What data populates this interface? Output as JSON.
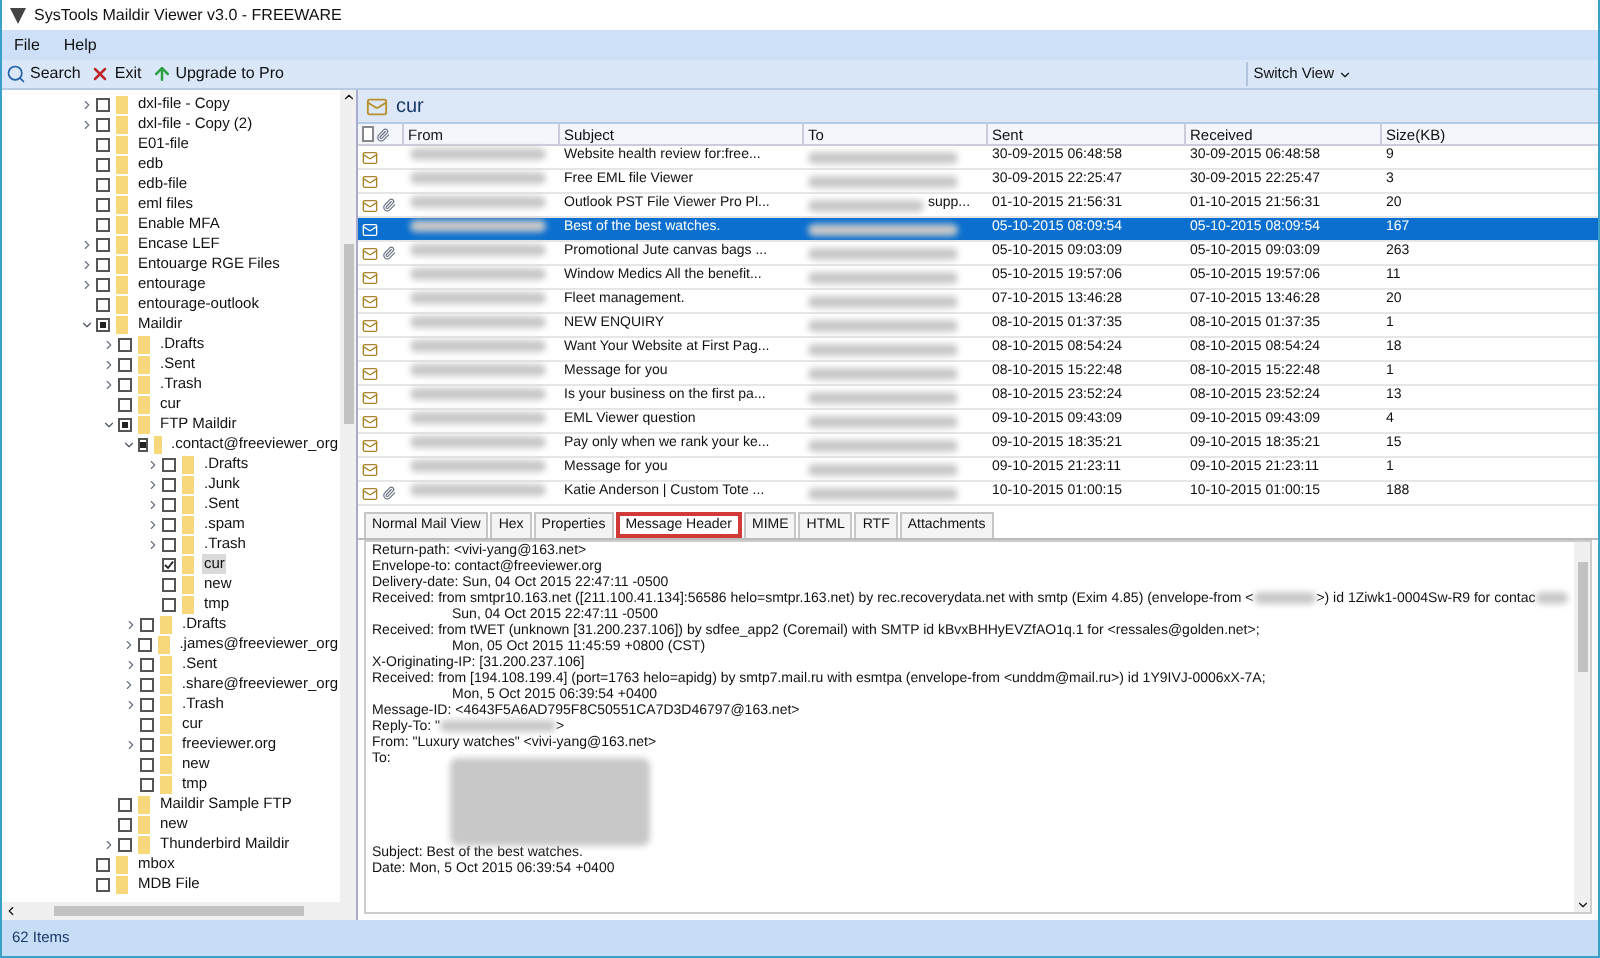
{
  "window": {
    "title": "SysTools Maildir Viewer v3.0 - FREEWARE"
  },
  "menu": [
    "File",
    "Help"
  ],
  "toolbar": [
    {
      "kind": "search",
      "label": "Search"
    },
    {
      "kind": "exit",
      "label": "Exit"
    },
    {
      "kind": "upgrade",
      "label": "Upgrade to Pro"
    }
  ],
  "switch_view": "Switch View",
  "tree": [
    {
      "label": "dxl-file - Copy",
      "checked": false,
      "expanded": false,
      "selected": false
    },
    {
      "label": "dxl-file - Copy (2)",
      "checked": false,
      "expanded": false,
      "selected": false
    },
    {
      "label": "E01-file",
      "checked": false,
      "selected": false
    },
    {
      "label": "edb",
      "checked": false,
      "selected": false
    },
    {
      "label": "edb-file",
      "checked": false,
      "selected": false
    },
    {
      "label": "eml files",
      "checked": false,
      "selected": false
    },
    {
      "label": "Enable MFA",
      "checked": false,
      "selected": false
    },
    {
      "label": "Encase LEF",
      "checked": false,
      "expanded": false,
      "selected": false
    },
    {
      "label": "Entouarge RGE Files",
      "checked": false,
      "expanded": false,
      "selected": false
    },
    {
      "label": "entourage",
      "checked": false,
      "expanded": false,
      "selected": false
    },
    {
      "label": "entourage-outlook",
      "checked": false,
      "selected": false
    },
    {
      "label": "Maildir",
      "partial": true,
      "expanded": true,
      "selected": false,
      "children": [
        {
          "label": ".Drafts",
          "checked": false,
          "expanded": false,
          "selected": false
        },
        {
          "label": ".Sent",
          "checked": false,
          "expanded": false,
          "selected": false
        },
        {
          "label": ".Trash",
          "checked": false,
          "expanded": false,
          "selected": false
        },
        {
          "label": "cur",
          "checked": false,
          "selected": false
        },
        {
          "label": "FTP Maildir",
          "partial": true,
          "expanded": true,
          "selected": false,
          "children": [
            {
              "label": ".contact@freeviewer_org",
              "partial": true,
              "expanded": true,
              "selected": false,
              "children": [
                {
                  "label": ".Drafts",
                  "checked": false,
                  "expanded": false,
                  "selected": false
                },
                {
                  "label": ".Junk",
                  "checked": false,
                  "expanded": false,
                  "selected": false
                },
                {
                  "label": ".Sent",
                  "checked": false,
                  "expanded": false,
                  "selected": false
                },
                {
                  "label": ".spam",
                  "checked": false,
                  "expanded": false,
                  "selected": false
                },
                {
                  "label": ".Trash",
                  "checked": false,
                  "expanded": false,
                  "selected": false
                },
                {
                  "label": "cur",
                  "checked": true,
                  "selected": true
                },
                {
                  "label": "new",
                  "checked": false,
                  "selected": false
                },
                {
                  "label": "tmp",
                  "checked": false,
                  "selected": false
                }
              ]
            },
            {
              "label": ".Drafts",
              "checked": false,
              "expanded": false,
              "selected": false
            },
            {
              "label": ".james@freeviewer_org",
              "checked": false,
              "expanded": false,
              "selected": false
            },
            {
              "label": ".Sent",
              "checked": false,
              "expanded": false,
              "selected": false
            },
            {
              "label": ".share@freeviewer_org",
              "checked": false,
              "expanded": false,
              "selected": false
            },
            {
              "label": ".Trash",
              "checked": false,
              "expanded": false,
              "selected": false
            },
            {
              "label": "cur",
              "checked": false,
              "selected": false
            },
            {
              "label": "freeviewer.org",
              "checked": false,
              "expanded": false,
              "selected": false
            },
            {
              "label": "new",
              "checked": false,
              "selected": false
            },
            {
              "label": "tmp",
              "checked": false,
              "selected": false
            }
          ]
        },
        {
          "label": "Maildir Sample FTP",
          "checked": false,
          "selected": false
        },
        {
          "label": "new",
          "checked": false,
          "selected": false
        },
        {
          "label": "Thunderbird Maildir",
          "checked": false,
          "expanded": false,
          "selected": false
        }
      ]
    },
    {
      "label": "mbox",
      "checked": false,
      "selected": false
    },
    {
      "label": "MDB File",
      "checked": false,
      "selected": false
    }
  ],
  "folder_title": "cur",
  "table": {
    "columns": [
      "From",
      "Subject",
      "To",
      "Sent",
      "Received",
      "Size(KB)"
    ],
    "rows": [
      {
        "attachment": false,
        "selected": false,
        "subject": "Website health review for:free...",
        "sent": "30-09-2015 06:48:58",
        "received": "30-09-2015 06:48:58",
        "size": "9"
      },
      {
        "attachment": false,
        "selected": false,
        "subject": "Free EML file Viewer",
        "sent": "30-09-2015 22:25:47",
        "received": "30-09-2015 22:25:47",
        "size": "3"
      },
      {
        "attachment": true,
        "selected": false,
        "subject": "Outlook PST File Viewer Pro Pl...",
        "to_suffix": "supp...",
        "sent": "01-10-2015 21:56:31",
        "received": "01-10-2015 21:56:31",
        "size": "20"
      },
      {
        "attachment": false,
        "selected": true,
        "subject": "Best of the best watches.",
        "sent": "05-10-2015 08:09:54",
        "received": "05-10-2015 08:09:54",
        "size": "167"
      },
      {
        "attachment": true,
        "selected": false,
        "subject": "Promotional Jute canvas bags ...",
        "sent": "05-10-2015 09:03:09",
        "received": "05-10-2015 09:03:09",
        "size": "263"
      },
      {
        "attachment": false,
        "selected": false,
        "subject": "Window Medics All the benefit...",
        "sent": "05-10-2015 19:57:06",
        "received": "05-10-2015 19:57:06",
        "size": "11"
      },
      {
        "attachment": false,
        "selected": false,
        "subject": "Fleet management.",
        "sent": "07-10-2015 13:46:28",
        "received": "07-10-2015 13:46:28",
        "size": "20"
      },
      {
        "attachment": false,
        "selected": false,
        "subject": "NEW ENQUIRY",
        "sent": "08-10-2015 01:37:35",
        "received": "08-10-2015 01:37:35",
        "size": "1"
      },
      {
        "attachment": false,
        "selected": false,
        "subject": "Want Your Website at First Pag...",
        "sent": "08-10-2015 08:54:24",
        "received": "08-10-2015 08:54:24",
        "size": "18"
      },
      {
        "attachment": false,
        "selected": false,
        "subject": "Message for you",
        "sent": "08-10-2015 15:22:48",
        "received": "08-10-2015 15:22:48",
        "size": "1"
      },
      {
        "attachment": false,
        "selected": false,
        "subject": "Is your business on the first pa...",
        "sent": "08-10-2015 23:52:24",
        "received": "08-10-2015 23:52:24",
        "size": "13"
      },
      {
        "attachment": false,
        "selected": false,
        "subject": "EML Viewer question",
        "sent": "09-10-2015 09:43:09",
        "received": "09-10-2015 09:43:09",
        "size": "4"
      },
      {
        "attachment": false,
        "selected": false,
        "subject": "Pay only when we rank your ke...",
        "sent": "09-10-2015 18:35:21",
        "received": "09-10-2015 18:35:21",
        "size": "15"
      },
      {
        "attachment": false,
        "selected": false,
        "subject": "Message for you",
        "sent": "09-10-2015 21:23:11",
        "received": "09-10-2015 21:23:11",
        "size": "1"
      },
      {
        "attachment": true,
        "selected": false,
        "subject": "Katie Anderson | Custom  Tote ...",
        "sent": "10-10-2015 01:00:15",
        "received": "10-10-2015 01:00:15",
        "size": "188"
      }
    ]
  },
  "view_tabs": [
    {
      "label": "Normal Mail View",
      "selected": false
    },
    {
      "label": "Hex",
      "selected": false
    },
    {
      "label": "Properties",
      "selected": false
    },
    {
      "label": "Message Header",
      "selected": true
    },
    {
      "label": "MIME",
      "selected": false
    },
    {
      "label": "HTML",
      "selected": false
    },
    {
      "label": "RTF",
      "selected": false
    },
    {
      "label": "Attachments",
      "selected": false
    }
  ],
  "header_lines": [
    {
      "kind": "field",
      "segments": [
        "Return-path: <vivi-yang@163.net>"
      ]
    },
    {
      "kind": "field",
      "segments": [
        "Envelope-to: contact@freeviewer.org"
      ]
    },
    {
      "kind": "field",
      "segments": [
        "Delivery-date: Sun, 04 Oct 2015 22:47:11 -0500"
      ]
    },
    {
      "kind": "field",
      "segments": [
        "Received: from smtpr10.163.net ([211.100.41.134]:56586 helo=smtpr.163.net) by rec.recoverydata.net with smtp (Exim 4.85) (envelope-from <",
        ">) id 1Ziwk1-0004Sw-R9 for contac"
      ],
      "redacted_end": true
    },
    {
      "kind": "continuation",
      "segments": [
        "Sun, 04 Oct 2015 22:47:11 -0500"
      ]
    },
    {
      "kind": "field",
      "segments": [
        "Received: from tWET (unknown [31.200.237.106]) by sdfee_app2 (Coremail) with SMTP id kBvxBHHyEVZfAO1q.1 for <ressales@golden.net>;"
      ]
    },
    {
      "kind": "continuation",
      "segments": [
        "Mon, 05 Oct 2015 11:45:59 +0800 (CST)"
      ]
    },
    {
      "kind": "field",
      "segments": [
        "X-Originating-IP: [31.200.237.106]"
      ]
    },
    {
      "kind": "field",
      "segments": [
        "Received: from [194.108.199.4] (port=1763 helo=apidg) by smtp7.mail.ru with esmtpa (envelope-from <unddm@mail.ru>) id 1Y9IVJ-0006xX-7A;"
      ]
    },
    {
      "kind": "continuation",
      "segments": [
        "Mon, 5 Oct 2015 06:39:54 +0400"
      ]
    },
    {
      "kind": "field",
      "segments": [
        "Message-ID: <4643F5A6AD795F8C50551CA7D3D46797@163.net>"
      ]
    },
    {
      "kind": "field",
      "segments": [
        "Reply-To: \"",
        ">"
      ]
    },
    {
      "kind": "field",
      "segments": [
        "From: \"Luxury watches\" <vivi-yang@163.net>"
      ]
    },
    {
      "kind": "field",
      "segments": [
        "To: "
      ],
      "redacted_end": true,
      "redacted_block": true
    },
    {
      "kind": "field",
      "segments": [
        "Subject: Best of the best watches."
      ]
    },
    {
      "kind": "field",
      "segments": [
        "Date: Mon, 5 Oct 2015 06:39:54 +0400"
      ]
    }
  ],
  "status_bar": "62 Items"
}
